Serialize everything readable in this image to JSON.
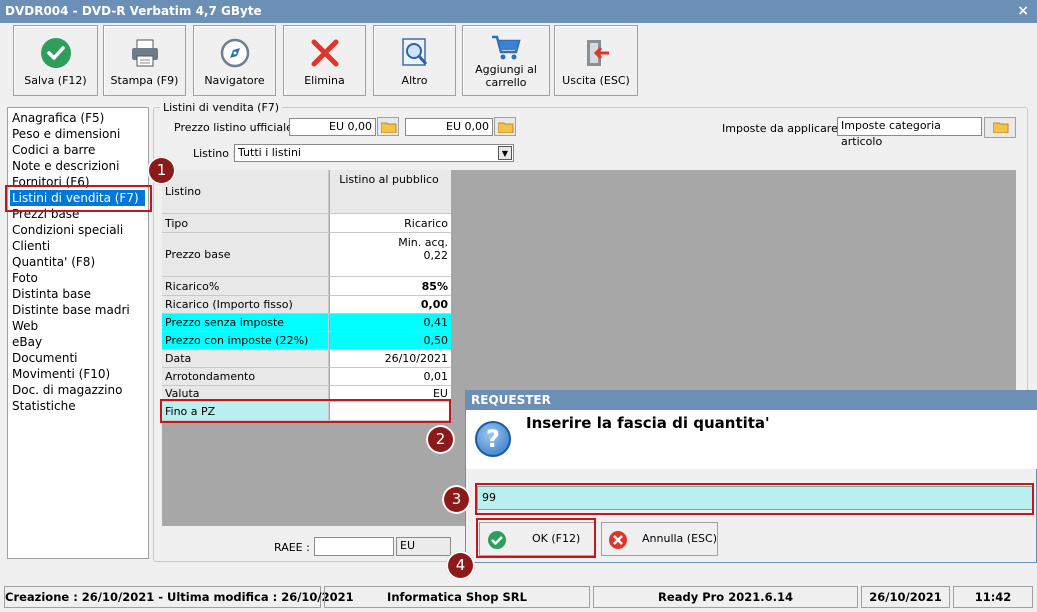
{
  "window": {
    "title": "DVDR004 - DVD-R Verbatim 4,7 GByte",
    "close": "×"
  },
  "toolbar": {
    "save": "Salva (F12)",
    "print": "Stampa (F9)",
    "navigator": "Navigatore",
    "delete": "Elimina",
    "other": "Altro",
    "add_cart_1": "Aggiungi al",
    "add_cart_2": "carrello",
    "exit": "Uscita (ESC)"
  },
  "sidebar": {
    "items": [
      "Anagrafica (F5)",
      "Peso e dimensioni",
      "Codici a barre",
      "Note e descrizioni",
      "Fornitori (F6)",
      "Listini di vendita (F7)",
      "Prezzi base",
      "Condizioni speciali",
      "Clienti",
      "Quantita' (F8)",
      "Foto",
      "Distinta base",
      "Distinte base madri",
      "Web",
      "eBay",
      "Documenti",
      "Movimenti (F10)",
      "Doc. di magazzino",
      "Statistiche"
    ],
    "selected": 5
  },
  "listini": {
    "group_title": "Listini di vendita (F7)",
    "prezzo_label": "Prezzo listino ufficiale :",
    "prezzo_1": "EU 0,00",
    "prezzo_2": "EU 0,00",
    "imposte_label": "Imposte da applicare :",
    "imposte_value": "Imposte categoria articolo",
    "listino_label": "Listino :",
    "listino_value": "Tutti i listini"
  },
  "grid": {
    "header_left": "Listino",
    "header_right": "Listino al pubblico",
    "rows": [
      {
        "label": "Tipo",
        "value": "Ricarico"
      },
      {
        "label": "Prezzo base",
        "value": "0,22",
        "sub": "Min. acq."
      },
      {
        "label": "Ricarico%",
        "value": "85%"
      },
      {
        "label": "Ricarico (Importo fisso)",
        "value": "0,00"
      },
      {
        "label": "Prezzo senza imposte",
        "value": "0,41"
      },
      {
        "label": "Prezzo con imposte (22%)",
        "value": "0,50"
      },
      {
        "label": "Data",
        "value": "26/10/2021"
      },
      {
        "label": "Arrotondamento",
        "value": "0,01"
      },
      {
        "label": "Valuta",
        "value": "EU"
      },
      {
        "label": "Fino a PZ",
        "value": ""
      }
    ]
  },
  "raee": {
    "label": "RAEE :",
    "value": "",
    "currency": "EU"
  },
  "dialog": {
    "title": "REQUESTER",
    "message": "Inserire la fascia di quantita'",
    "input_value": "99",
    "ok": "OK (F12)",
    "cancel": "Annulla (ESC)"
  },
  "badges": [
    "1",
    "2",
    "3",
    "4"
  ],
  "status": {
    "created": "Creazione : 26/10/2021 - Ultima modifica : 26/10/2021",
    "company": "Informatica Shop SRL",
    "version": "Ready Pro 2021.6.14",
    "date": "26/10/2021",
    "time": "11:42"
  },
  "colors": {
    "titlebar": "#6c8fb6",
    "highlight": "#00ffff",
    "annotation": "#c4171b",
    "selection": "#0078d7"
  }
}
